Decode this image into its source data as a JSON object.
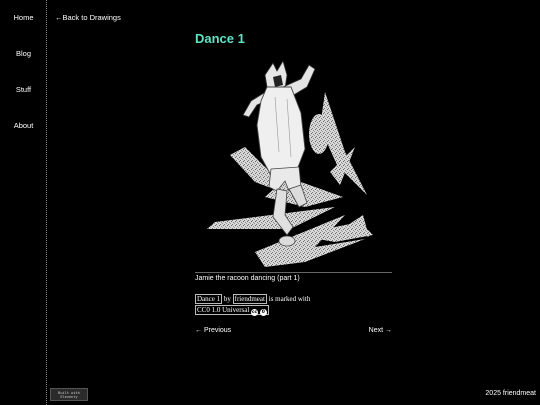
{
  "nav": {
    "items": [
      {
        "label": "Home"
      },
      {
        "label": "Blog"
      },
      {
        "label": "Stuff"
      },
      {
        "label": "About"
      }
    ]
  },
  "back_link": "←Back to Drawings",
  "page": {
    "title": "Dance 1",
    "caption": "Jamie the racoon dancing (part 1)"
  },
  "license": {
    "work_title": "Dance 1",
    "by": "by",
    "author": "friendmeat",
    "marked_with": "is marked with",
    "license_name": "CC0 1.0 Universal",
    "icon_cc": "cc-icon",
    "icon_zero": "cc-zero-icon"
  },
  "pager": {
    "previous": "← Previous",
    "next": "Next →"
  },
  "badge": {
    "line1": "Built with",
    "line2": "Eleventy"
  },
  "footer": {
    "text": "2025 friendmeat"
  },
  "colors": {
    "background": "#000000",
    "title": "#5ee3c4",
    "text": "#ffffff"
  }
}
